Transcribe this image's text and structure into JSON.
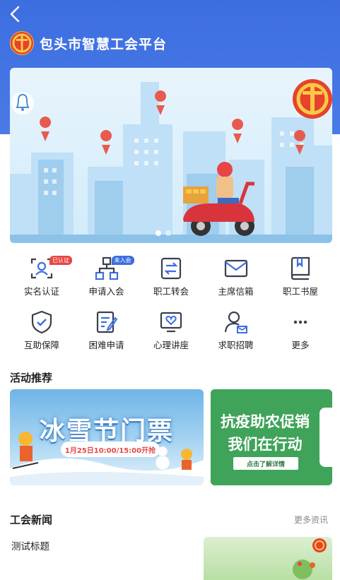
{
  "header": {
    "back_icon": "chevron-left-icon",
    "title": "包头市智慧工会平台"
  },
  "colors": {
    "header_blue": "#3d6ee0",
    "badge_red": "#e84545",
    "green_card": "#3fa35a"
  },
  "banner": {
    "slides": 2,
    "active_slide": 1
  },
  "services": {
    "row1": [
      {
        "label": "实名认证",
        "icon": "face-scan-icon",
        "badge": "已认证"
      },
      {
        "label": "申请入会",
        "icon": "org-chart-icon",
        "badge": "未入会"
      },
      {
        "label": "职工转会",
        "icon": "transfer-icon",
        "badge": ""
      },
      {
        "label": "主席信箱",
        "icon": "mail-icon",
        "badge": ""
      },
      {
        "label": "职工书屋",
        "icon": "book-icon",
        "badge": ""
      }
    ],
    "row2": [
      {
        "label": "互助保障",
        "icon": "shield-check-icon"
      },
      {
        "label": "困难申请",
        "icon": "form-edit-icon"
      },
      {
        "label": "心理讲座",
        "icon": "heart-screen-icon"
      },
      {
        "label": "求职招聘",
        "icon": "user-mail-icon"
      },
      {
        "label": "更多",
        "icon": "more-dots-icon"
      }
    ]
  },
  "activities": {
    "section_title": "活动推荐",
    "card1": {
      "headline": "冰雪节门票",
      "pill": "1月25日10:00/15:00开抢"
    },
    "card2": {
      "line1": "抗疫助农促销",
      "line2": "我们在行动",
      "button": "点击了解详情"
    }
  },
  "news": {
    "section_title": "工会新闻",
    "more_label": "更多资讯",
    "items": [
      {
        "title": "测试标题"
      }
    ]
  }
}
